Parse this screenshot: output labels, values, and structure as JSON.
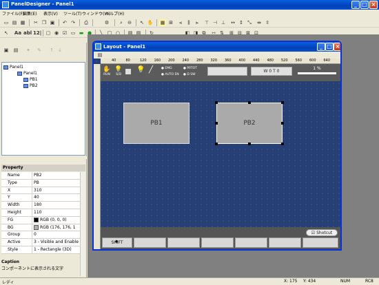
{
  "app": {
    "title": "PanelDesigner - Panel1"
  },
  "menu": [
    "ファイル(F)",
    "編集(E)",
    "表示(V)",
    "ツール(T)",
    "ウィンドウ(W)",
    "ヘルプ(H)"
  ],
  "toolbar": {
    "text_btn_aa": "Aa",
    "text_btn_abl": "abl",
    "text_btn_12": "12|"
  },
  "tree": {
    "root": "Panel1",
    "child": "Panel1",
    "items": [
      "PB1",
      "PB2"
    ]
  },
  "property": {
    "title": "Property",
    "rows": [
      {
        "key": "Name",
        "value": "PB2"
      },
      {
        "key": "Type",
        "value": "PB"
      },
      {
        "key": "X",
        "value": "310"
      },
      {
        "key": "Y",
        "value": "40"
      },
      {
        "key": "Width",
        "value": "180"
      },
      {
        "key": "Height",
        "value": "110"
      },
      {
        "key": "FG",
        "value": "RGB (0, 0, 0)",
        "swatch": "#000000"
      },
      {
        "key": "BG",
        "value": "RGB (176, 176, 1",
        "swatch": "#b0b0b0"
      },
      {
        "key": "Group",
        "value": "0"
      },
      {
        "key": "Active",
        "value": "3 - Visible and Enable"
      },
      {
        "key": "Style",
        "value": "1 - Rectangle (3D)"
      }
    ],
    "caption_title": "Caption",
    "caption_desc": "コンポーネントに表示される文字"
  },
  "layout": {
    "title": "Layout - Panel1",
    "ruler_ticks": [
      "40",
      "80",
      "120",
      "160",
      "200",
      "240",
      "280",
      "320",
      "360",
      "400",
      "440",
      "480",
      "520",
      "560",
      "600",
      "640"
    ],
    "ctl_labels": {
      "run": "RUN",
      "sd": "S/D",
      "emg": "EMG",
      "prtot": "PRTOT",
      "autoen": "AUTO EN",
      "dsw": "D SW"
    },
    "wo_button": "W 0 T 0",
    "percent": "1 %",
    "pb1": "PB1",
    "pb2": "PB2",
    "shotcut": "Shotcut",
    "shift": "SHIFT"
  },
  "status": {
    "left": "レディ",
    "x": "X:  175",
    "y": "Y:  434",
    "num": "NUM",
    "rc": "RC8"
  }
}
